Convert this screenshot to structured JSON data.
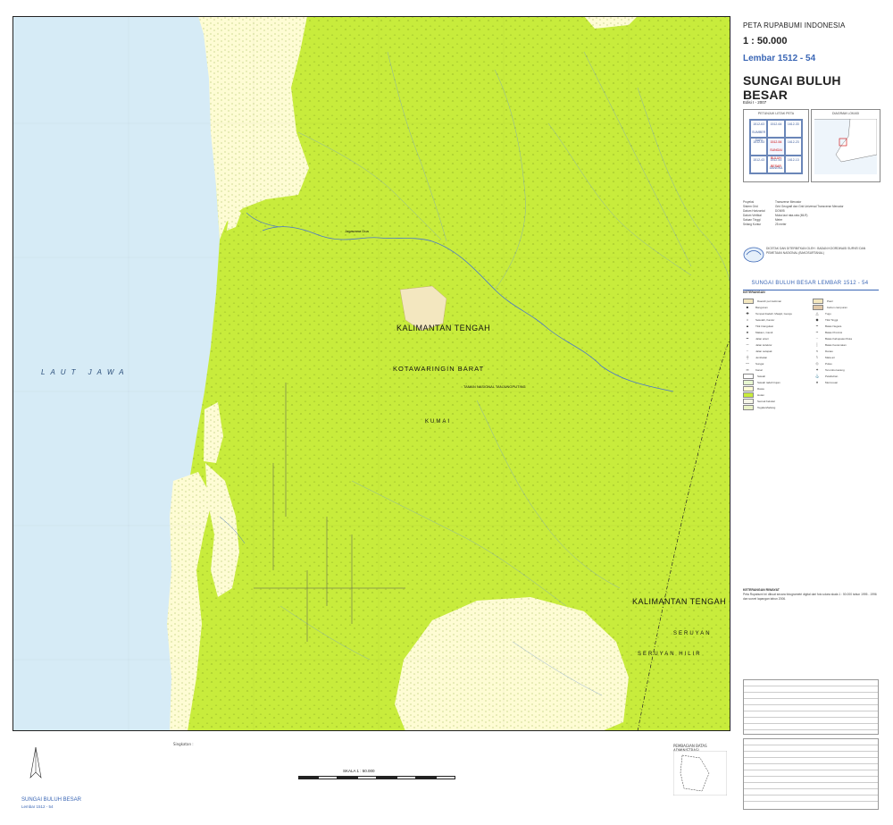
{
  "map": {
    "sea_label": "LAUT JAWA",
    "province_label": "KALIMANTAN TENGAH",
    "province_label_2": "KALIMANTAN TENGAH",
    "regency_label": "KOTAWARINGIN BARAT",
    "regency_label_2": "SERUYAN",
    "subdistrict_label": "KUMAI",
    "subdistrict_label_2": "SERUYAN HILIR",
    "park_label": "TAMAN NASIONAL TANJUNGPUTING",
    "place_label": "Jagawana Dua",
    "colors": {
      "sea": "#d6ebf6",
      "land": "#c8ec3c",
      "swamp": "#fefcd4",
      "sand": "#f3e7bf",
      "river": "#4b76c9",
      "boundary": "#222222"
    }
  },
  "panel": {
    "header": "PETA RUPABUMI INDONESIA",
    "scale": "1 : 50.000",
    "sheet": "Lembar 1512 - 54",
    "name": "SUNGAI BULUH BESAR",
    "edition": "Edisi I - 2007",
    "index_title": "PETUNJUK LETAK PETA",
    "index_sheets": [
      "1512-63 SUMBER SARI",
      "1512-64",
      "1612-33",
      "1512-53",
      "1512-54 SUNGAI BULUH BESAR",
      "1612-23",
      "1512-43",
      "1512-44 DANGKA",
      "1612-13"
    ],
    "location_title": "DIAGRAM LOKASI",
    "metadata": [
      [
        "Proyeksi",
        "Transverse Mercator"
      ],
      [
        "Sistem Grid",
        "Grid Geografi dan Grid Universal Transverse Mercator"
      ],
      [
        "Datum Horizontal",
        "DGN95"
      ],
      [
        "Datum Vertikal",
        "Muka laut rata-rata (MLR)"
      ],
      [
        "Satuan Tinggi",
        "Meter"
      ],
      [
        "Selang Kontur",
        "25 meter"
      ]
    ],
    "agency": "DICETAK DAN DITERBITKAN OLEH : BADAN KOORDINASI SURVEI DAN PEMETAAN NASIONAL (BAKOSURTANAL)",
    "sheet_banner": "SUNGAI BULUH BESAR  LEMBAR  1512 - 54",
    "legend_title": "KETERANGAN",
    "legend_left": [
      [
        "sw",
        "#f3e7bf",
        "Daerah permukiman"
      ],
      [
        "sym",
        "■",
        "Bangunan"
      ],
      [
        "sym",
        "✚",
        "Tempat ibadah: Masjid, Gereja"
      ],
      [
        "sym",
        "⌂",
        "Sekolah, Kantor"
      ],
      [
        "sym",
        "▲",
        "Titik triangulasi"
      ],
      [
        "sym",
        "●",
        "Makam, Candi"
      ],
      [
        "sym",
        "━",
        "Jalan arteri"
      ],
      [
        "sym",
        "─",
        "Jalan kolektor"
      ],
      [
        "sym",
        "┄",
        "Jalan setapak"
      ],
      [
        "sym",
        "┼",
        "Jembatan"
      ],
      [
        "sym",
        "〰",
        "Sungai"
      ],
      [
        "sym",
        "═",
        "Kanal"
      ],
      [
        "sw",
        "#ffffff",
        "Sawah"
      ],
      [
        "sw",
        "#e8f7d0",
        "Sawah tadah hujan"
      ],
      [
        "sw",
        "#fefcd4",
        "Rawa"
      ],
      [
        "sw",
        "#c8ec3c",
        "Hutan"
      ],
      [
        "sw",
        "#f6f6e8",
        "Semak belukar"
      ],
      [
        "sw",
        "#eaf3c6",
        "Tegalan/ladang"
      ]
    ],
    "legend_right": [
      [
        "sw",
        "#f3e7bf",
        "Pasir"
      ],
      [
        "sw",
        "#e0c8a8",
        "Kebun campuran"
      ],
      [
        "sym",
        "△",
        "Tugu"
      ],
      [
        "sym",
        "◆",
        "Titik Tinggi"
      ],
      [
        "sym",
        "┅",
        "Batas Negara"
      ],
      [
        "sym",
        "┉",
        "Batas Provinsi"
      ],
      [
        "sym",
        "┈",
        "Batas Kabupaten/Kota"
      ],
      [
        "sym",
        "┊",
        "Batas Kecamatan"
      ],
      [
        "sym",
        "≈",
        "Danau"
      ],
      [
        "sym",
        "⌇",
        "Mata air"
      ],
      [
        "sym",
        "◇",
        "Pulau"
      ],
      [
        "sym",
        "✦",
        "Terumbu karang"
      ],
      [
        "sym",
        "⚓",
        "Pelabuhan"
      ],
      [
        "sym",
        "♦",
        "Mercusuar"
      ]
    ],
    "notes_title": "KETERANGAN RIWAYAT",
    "notes": "Peta Rupabumi ini dibuat secara fotogrametri digital dari foto udara skala 1 : 50.000 tahun 1995 - 1996 dan survei lapangan tahun 2006."
  },
  "bottom": {
    "sheet_title": "SUNGAI BULUH BESAR",
    "sheet_sub": "Lembar 1512 - 54",
    "scale_label": "SKALA 1 : 50.000",
    "abbreviations": "Singkatan :",
    "boundary_title": "PEMBAGIAN BATAS ADMINISTRASI"
  }
}
